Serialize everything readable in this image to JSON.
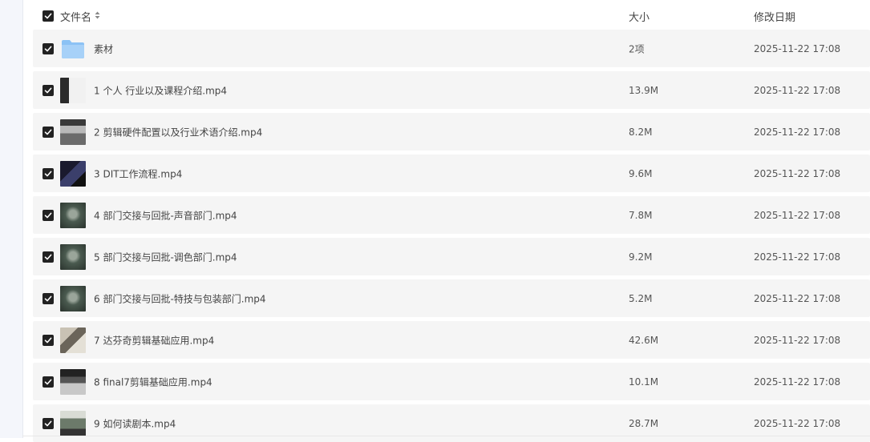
{
  "header": {
    "name_label": "文件名",
    "size_label": "大小",
    "date_label": "修改日期"
  },
  "rows": [
    {
      "name": "素材",
      "size": "2项",
      "date": "2025-11-22 17:08",
      "icon": "folder-icon"
    },
    {
      "name": "1 个人 行业以及课程介绍.mp4",
      "size": "13.9M",
      "date": "2025-11-22 17:08",
      "icon": "video-thumbnail"
    },
    {
      "name": "2 剪辑硬件配置以及行业术语介绍.mp4",
      "size": "8.2M",
      "date": "2025-11-22 17:08",
      "icon": "video-thumbnail"
    },
    {
      "name": "3 DIT工作流程.mp4",
      "size": "9.6M",
      "date": "2025-11-22 17:08",
      "icon": "video-thumbnail"
    },
    {
      "name": "4 部门交接与回批-声音部门.mp4",
      "size": "7.8M",
      "date": "2025-11-22 17:08",
      "icon": "video-thumbnail"
    },
    {
      "name": "5 部门交接与回批-调色部门.mp4",
      "size": "9.2M",
      "date": "2025-11-22 17:08",
      "icon": "video-thumbnail"
    },
    {
      "name": "6 部门交接与回批-特技与包装部门.mp4",
      "size": "5.2M",
      "date": "2025-11-22 17:08",
      "icon": "video-thumbnail"
    },
    {
      "name": "7 达芬奇剪辑基础应用.mp4",
      "size": "42.6M",
      "date": "2025-11-22 17:08",
      "icon": "video-thumbnail"
    },
    {
      "name": "8 final7剪辑基础应用.mp4",
      "size": "10.1M",
      "date": "2025-11-22 17:08",
      "icon": "video-thumbnail"
    },
    {
      "name": "9 如何读剧本.mp4",
      "size": "28.7M",
      "date": "2025-11-22 17:08",
      "icon": "video-thumbnail"
    }
  ],
  "colors": {
    "row_background": "#f5f5f5",
    "checkbox": "#222222",
    "folder": "#8cc2f5"
  }
}
